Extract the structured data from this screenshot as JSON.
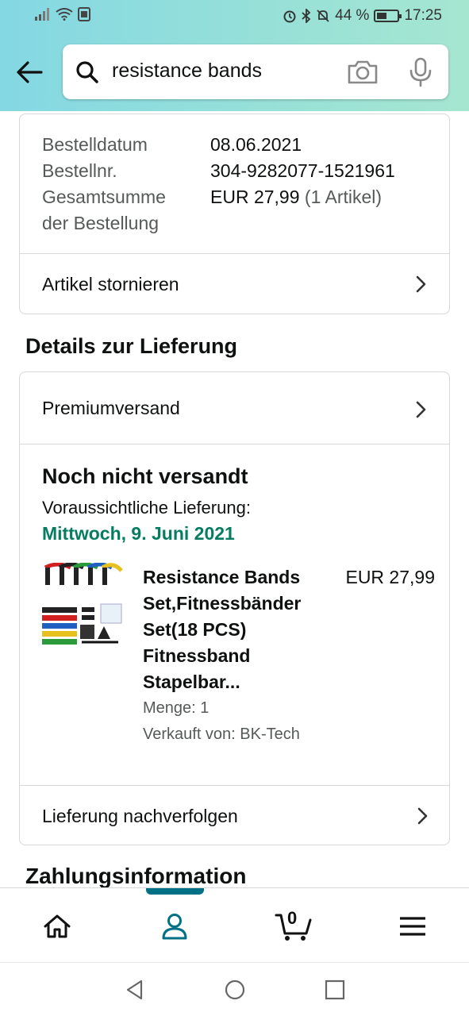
{
  "status_bar": {
    "battery": "44 %",
    "time": "17:25"
  },
  "search": {
    "query": "resistance bands"
  },
  "order": {
    "rows": [
      {
        "label": "Bestelldatum",
        "value": "08.06.2021",
        "extra": ""
      },
      {
        "label": "Bestellnr.",
        "value": "304-9282077-1521961",
        "extra": ""
      },
      {
        "label": "Gesamtsumme",
        "value": "EUR 27,99",
        "extra": "(1 Artikel)"
      },
      {
        "label": "der Bestellung",
        "value": "",
        "extra": ""
      }
    ],
    "cancel_label": "Artikel stornieren"
  },
  "delivery": {
    "section_title": "Details zur Lieferung",
    "shipping_method": "Premiumversand",
    "status": "Noch nicht versandt",
    "est_label": "Voraussichtliche Lieferung:",
    "est_date": "Mittwoch, 9. Juni 2021",
    "product": {
      "title": "Resistance Bands Set,Fitnessbänder Set(18 PCS) Fitnessband Stapelbar...",
      "price": "EUR 27,99",
      "quantity": "Menge: 1",
      "seller": "Verkauft von: BK-Tech"
    },
    "track_label": "Lieferung nachverfolgen"
  },
  "payment": {
    "section_title": "Zahlungsinformation"
  },
  "bottom_nav": {
    "cart_count": "0"
  },
  "colors": {
    "accent": "#007185",
    "delivery_green": "#067d62"
  }
}
